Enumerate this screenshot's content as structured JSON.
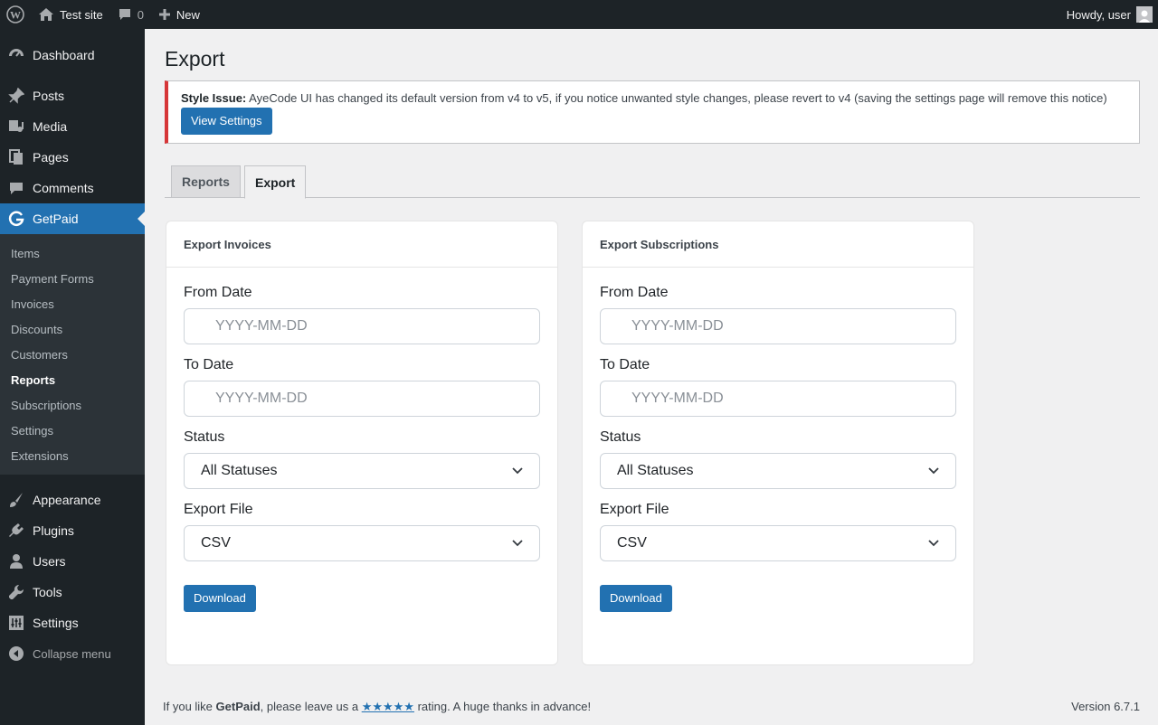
{
  "admin_bar": {
    "site_name": "Test site",
    "comments_count": "0",
    "new_label": "New",
    "greeting": "Howdy, user"
  },
  "sidebar": {
    "top_items": [
      {
        "label": "Dashboard",
        "icon": "dashboard-icon"
      },
      {
        "label": "Posts",
        "icon": "pin-icon"
      },
      {
        "label": "Media",
        "icon": "media-icon"
      },
      {
        "label": "Pages",
        "icon": "pages-icon"
      },
      {
        "label": "Comments",
        "icon": "comment-icon"
      },
      {
        "label": "GetPaid",
        "icon": "getpaid-icon"
      }
    ],
    "submenu": [
      "Items",
      "Payment Forms",
      "Invoices",
      "Discounts",
      "Customers",
      "Reports",
      "Subscriptions",
      "Settings",
      "Extensions"
    ],
    "bottom_items": [
      {
        "label": "Appearance",
        "icon": "brush-icon"
      },
      {
        "label": "Plugins",
        "icon": "plugin-icon"
      },
      {
        "label": "Users",
        "icon": "user-icon"
      },
      {
        "label": "Tools",
        "icon": "wrench-icon"
      },
      {
        "label": "Settings",
        "icon": "settings-icon"
      }
    ],
    "collapse_label": "Collapse menu"
  },
  "page": {
    "title": "Export"
  },
  "notice": {
    "strong": "Style Issue:",
    "text": " AyeCode UI has changed its default version from v4 to v5, if you notice unwanted style changes, please revert to v4 (saving the settings page will remove this notice)",
    "button": "View Settings"
  },
  "tabs": [
    "Reports",
    "Export"
  ],
  "cards": [
    {
      "title": "Export Invoices",
      "from_label": "From Date",
      "from_placeholder": "YYYY-MM-DD",
      "to_label": "To Date",
      "to_placeholder": "YYYY-MM-DD",
      "status_label": "Status",
      "status_value": "All Statuses",
      "file_label": "Export File",
      "file_value": "CSV",
      "button": "Download"
    },
    {
      "title": "Export Subscriptions",
      "from_label": "From Date",
      "from_placeholder": "YYYY-MM-DD",
      "to_label": "To Date",
      "to_placeholder": "YYYY-MM-DD",
      "status_label": "Status",
      "status_value": "All Statuses",
      "file_label": "Export File",
      "file_value": "CSV",
      "button": "Download"
    }
  ],
  "footer": {
    "text_before": "If you like ",
    "brand": "GetPaid",
    "text_middle": ", please leave us a ",
    "stars": "★★★★★",
    "text_after": " rating. A huge thanks in advance!",
    "version": "Version 6.7.1"
  },
  "colors": {
    "accent": "#2271b1",
    "admin_dark": "#1d2327",
    "notice_error": "#d63638"
  }
}
